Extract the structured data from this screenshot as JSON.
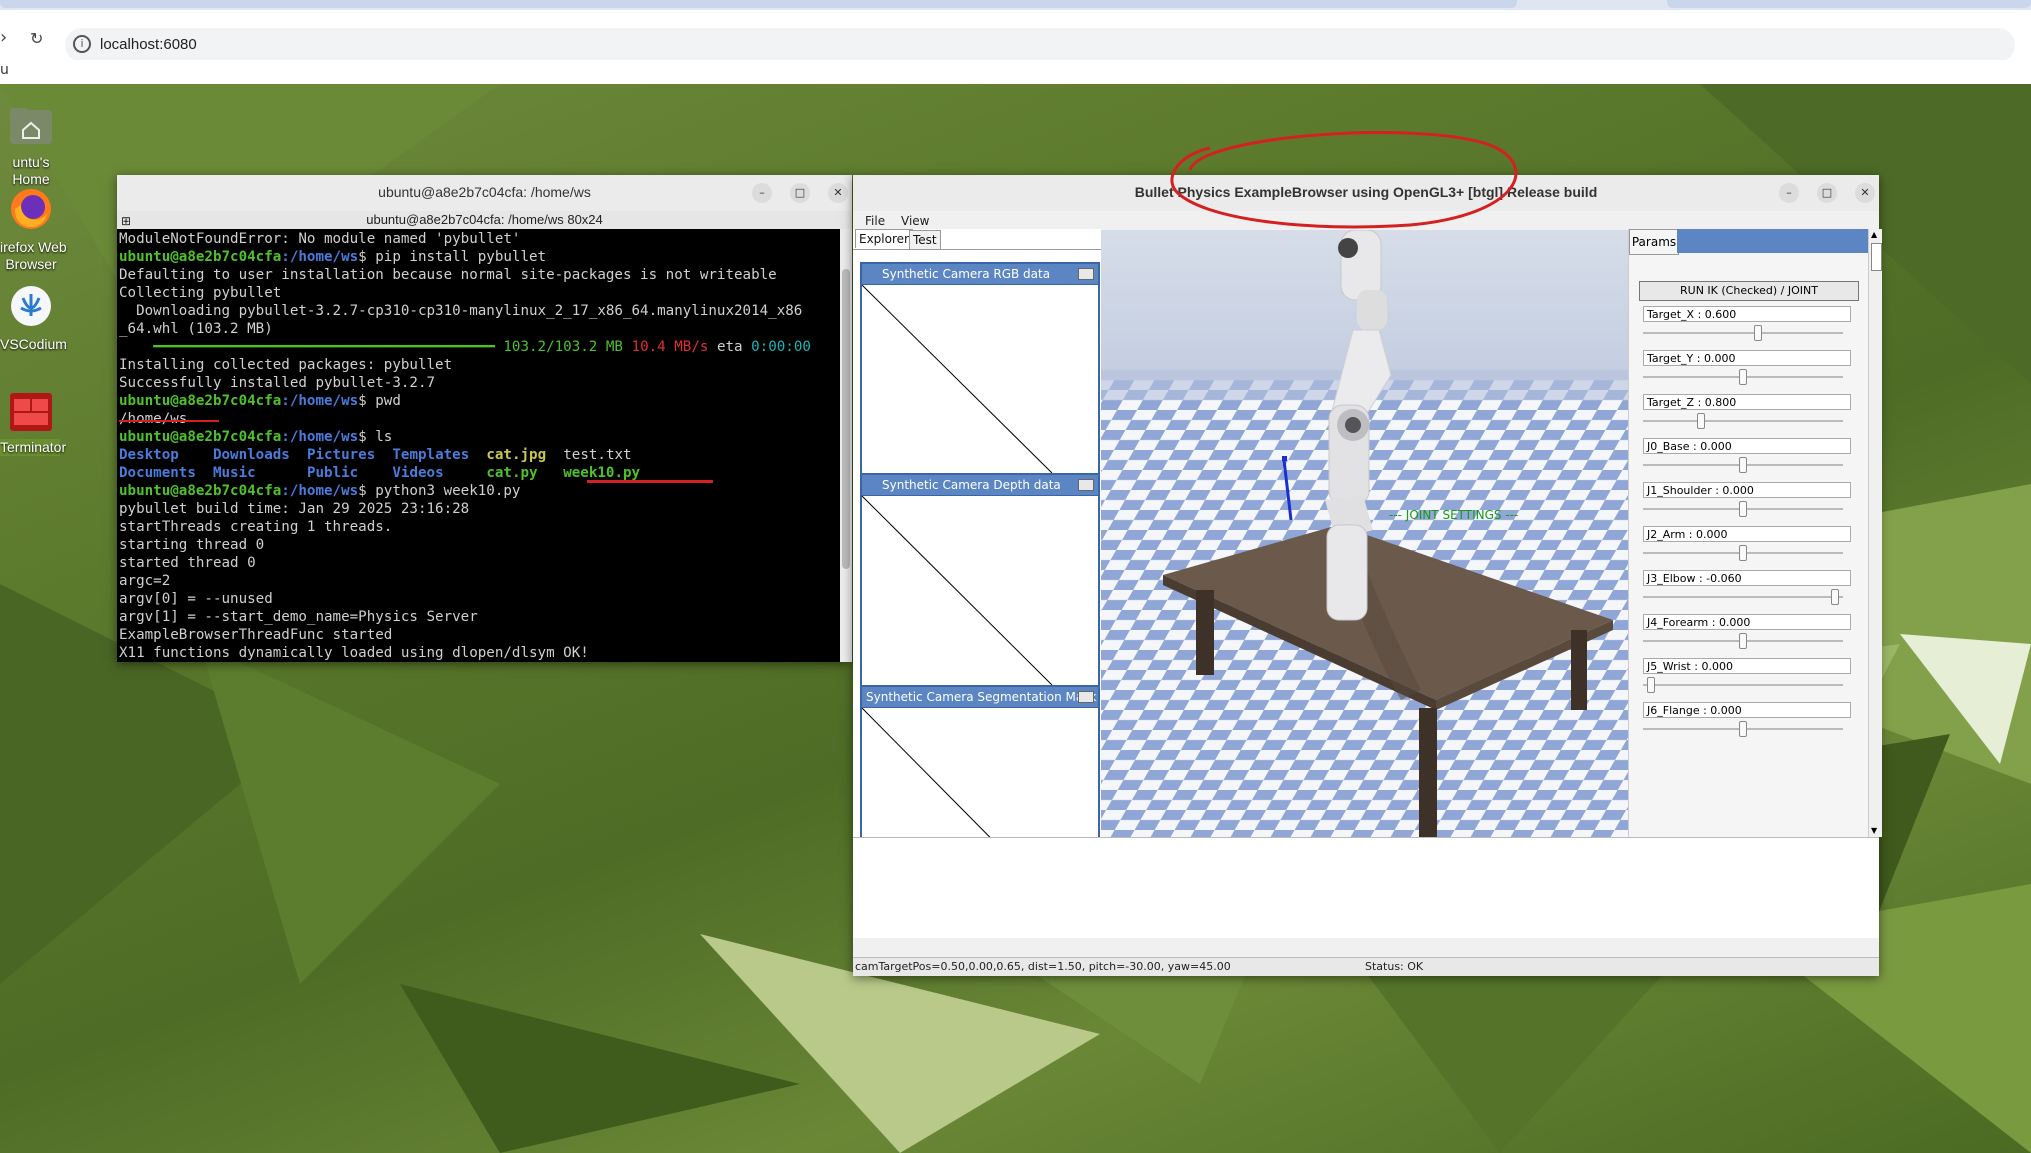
{
  "browser": {
    "url": "localhost:6080",
    "bookmark_fragment": "u"
  },
  "desktop_icons": [
    {
      "label": "untu's Home",
      "icon": "home-folder-icon"
    },
    {
      "label": "irefox Web\nBrowser",
      "icon": "firefox-icon"
    },
    {
      "label": "VSCodium",
      "icon": "vscodium-icon"
    },
    {
      "label": "Terminator",
      "icon": "terminator-icon"
    }
  ],
  "terminal": {
    "title": "ubuntu@a8e2b7c04cfa: /home/ws",
    "subtitle": "ubuntu@a8e2b7c04cfa: /home/ws 80x24",
    "prompt_user": "ubuntu@a8e2b7c04cfa",
    "prompt_path": ":/home/ws",
    "lines": {
      "l1": "ModuleNotFoundError: No module named 'pybullet'",
      "cmd1": "$ pip install pybullet",
      "l3": "Defaulting to user installation because normal site-packages is not writeable",
      "l4": "Collecting pybullet",
      "l5": "  Downloading pybullet-3.2.7-cp310-cp310-manylinux_2_17_x86_64.manylinux2014_x86",
      "l6": "_64.whl (103.2 MB)",
      "progress_size": "103.2/103.2 MB",
      "progress_speed": "10.4 MB/s",
      "progress_eta_label": "eta",
      "progress_eta": "0:00:00",
      "l8": "Installing collected packages: pybullet",
      "l9": "Successfully installed pybullet-3.2.7",
      "cmd2": "$ pwd",
      "l11": "/home/ws",
      "cmd3": "$ ls",
      "ls_row1": [
        "Desktop",
        "Downloads",
        "Pictures",
        "Templates",
        "cat.jpg",
        "test.txt"
      ],
      "ls_row2": [
        "Documents",
        "Music",
        "Public",
        "Videos",
        "cat.py",
        "week10.py"
      ],
      "cmd4": "$ python3 week10.py",
      "l15": "pybullet build time: Jan 29 2025 23:16:28",
      "l16": "startThreads creating 1 threads.",
      "l17": "starting thread 0",
      "l18": "started thread 0",
      "l19": "argc=2",
      "l20": "argv[0] = --unused",
      "l21": "argv[1] = --start_demo_name=Physics Server",
      "l22": "ExampleBrowserThreadFunc started",
      "l23": "X11 functions dynamically loaded using dlopen/dlsym OK!"
    }
  },
  "bullet": {
    "title": "Bullet Physics ExampleBrowser using OpenGL3+ [btgl] Release build",
    "menu": [
      "File",
      "View"
    ],
    "left_tabs": [
      "Explorer",
      "Test"
    ],
    "panels": [
      "Synthetic Camera RGB data",
      "Synthetic Camera Depth data",
      "Synthetic Camera Segmentation Mask"
    ],
    "joint_settings_label": "--- JOINT SETTINGS ---",
    "params_tab": "Params",
    "run_button": "RUN IK (Checked) / JOINT",
    "sliders": [
      {
        "label": "Target_X : 0.600",
        "fraction": 0.58
      },
      {
        "label": "Target_Y : 0.000",
        "fraction": 0.5
      },
      {
        "label": "Target_Z : 0.800",
        "fraction": 0.28
      },
      {
        "label": "J0_Base : 0.000",
        "fraction": 0.5
      },
      {
        "label": "J1_Shoulder : 0.000",
        "fraction": 0.5
      },
      {
        "label": "J2_Arm : 0.000",
        "fraction": 0.5
      },
      {
        "label": "J3_Elbow : -0.060",
        "fraction": 0.98
      },
      {
        "label": "J4_Forearm : 0.000",
        "fraction": 0.5
      },
      {
        "label": "J5_Wrist : 0.000",
        "fraction": 0.02
      },
      {
        "label": "J6_Flange : 0.000",
        "fraction": 0.5
      }
    ],
    "status_left": "camTargetPos=0.50,0.00,0.65, dist=1.50, pitch=-30.00, yaw=45.00",
    "status_right": "Status: OK"
  },
  "colors": {
    "annotation_red": "#d42020",
    "terminal_green": "#4ec22a",
    "terminal_blue": "#4a7cdc",
    "panel_blue": "#5b86c3"
  }
}
